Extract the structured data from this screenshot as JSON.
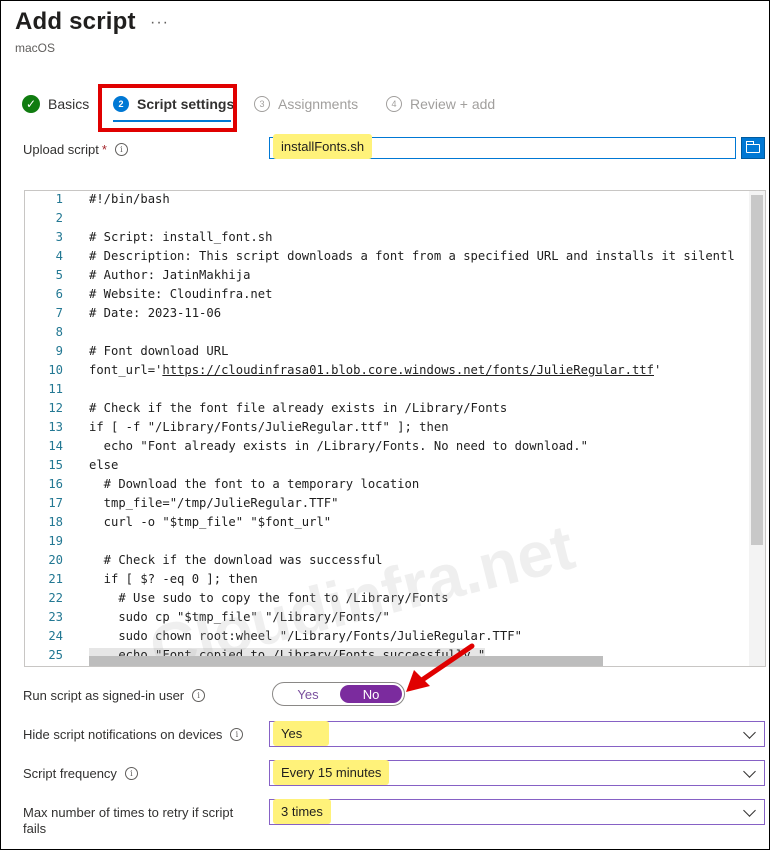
{
  "header": {
    "title": "Add script",
    "more": "···",
    "subtitle": "macOS"
  },
  "wizard": {
    "steps": [
      {
        "num": "✓",
        "label": "Basics",
        "state": "complete"
      },
      {
        "num": "2",
        "label": "Script settings",
        "state": "active"
      },
      {
        "num": "3",
        "label": "Assignments",
        "state": "disabled"
      },
      {
        "num": "4",
        "label": "Review + add",
        "state": "disabled"
      }
    ]
  },
  "upload": {
    "label": "Upload script",
    "required": "*",
    "value": "installFonts.sh",
    "browse_icon": "folder-icon"
  },
  "editor": {
    "watermark": "Cloudinfra.net",
    "lines": [
      {
        "n": "1",
        "text": "#!/bin/bash"
      },
      {
        "n": "2",
        "text": ""
      },
      {
        "n": "3",
        "text": "# Script: install_font.sh"
      },
      {
        "n": "4",
        "text": "# Description: This script downloads a font from a specified URL and installs it silentl"
      },
      {
        "n": "5",
        "text": "# Author: JatinMakhija"
      },
      {
        "n": "6",
        "text": "# Website: Cloudinfra.net"
      },
      {
        "n": "7",
        "text": "# Date: 2023-11-06"
      },
      {
        "n": "8",
        "text": ""
      },
      {
        "n": "9",
        "text": "# Font download URL"
      },
      {
        "n": "10",
        "text": "font_url='https://cloudinfrasa01.blob.core.windows.net/fonts/JulieRegular.ttf'"
      },
      {
        "n": "11",
        "text": ""
      },
      {
        "n": "12",
        "text": "# Check if the font file already exists in /Library/Fonts"
      },
      {
        "n": "13",
        "text": "if [ -f \"/Library/Fonts/JulieRegular.ttf\" ]; then"
      },
      {
        "n": "14",
        "text": "  echo \"Font already exists in /Library/Fonts. No need to download.\""
      },
      {
        "n": "15",
        "text": "else"
      },
      {
        "n": "16",
        "text": "  # Download the font to a temporary location"
      },
      {
        "n": "17",
        "text": "  tmp_file=\"/tmp/JulieRegular.TTF\""
      },
      {
        "n": "18",
        "text": "  curl -o \"$tmp_file\" \"$font_url\""
      },
      {
        "n": "19",
        "text": ""
      },
      {
        "n": "20",
        "text": "  # Check if the download was successful"
      },
      {
        "n": "21",
        "text": "  if [ $? -eq 0 ]; then"
      },
      {
        "n": "22",
        "text": "    # Use sudo to copy the font to /Library/Fonts"
      },
      {
        "n": "23",
        "text": "    sudo cp \"$tmp_file\" \"/Library/Fonts/\""
      },
      {
        "n": "24",
        "text": "    sudo chown root:wheel \"/Library/Fonts/JulieRegular.TTF\""
      },
      {
        "n": "25",
        "text": "    echo \"Font copied to /Library/Fonts successfully.\""
      }
    ]
  },
  "run_as_user": {
    "label": "Run script as signed-in user",
    "yes": "Yes",
    "no": "No",
    "selected": "No"
  },
  "hide_notifications": {
    "label": "Hide script notifications on devices",
    "value": "Yes"
  },
  "frequency": {
    "label": "Script frequency",
    "value": "Every 15 minutes"
  },
  "retry": {
    "label": "Max number of times to retry if script fails",
    "value": "3 times"
  },
  "colors": {
    "accent": "#0078d4",
    "toggle_on": "#7b2b9e",
    "highlight": "#fff27a",
    "annotation": "#e00000"
  }
}
